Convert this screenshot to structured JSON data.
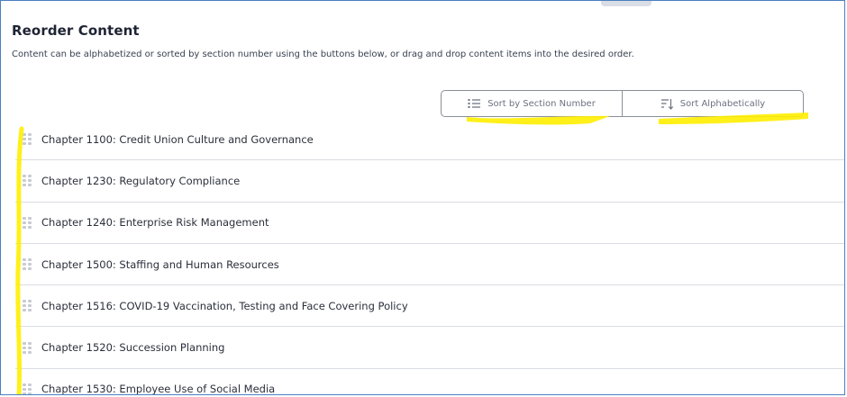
{
  "header": {
    "title": "Reorder Content",
    "description": "Content can be alphabetized or sorted by section number using the buttons below, or drag and drop content items into the desired order."
  },
  "sort_buttons": {
    "section": {
      "label": "Sort by Section Number",
      "icon": "list-ordered-icon"
    },
    "alpha": {
      "label": "Sort Alphabetically",
      "icon": "sort-descending-icon"
    }
  },
  "items": [
    {
      "label": "Chapter 1100: Credit Union Culture and Governance"
    },
    {
      "label": "Chapter 1230: Regulatory Compliance"
    },
    {
      "label": "Chapter 1240: Enterprise Risk Management"
    },
    {
      "label": "Chapter 1500: Staffing and Human Resources"
    },
    {
      "label": "Chapter 1516: COVID-19 Vaccination, Testing and Face Covering Policy"
    },
    {
      "label": "Chapter 1520: Succession Planning"
    },
    {
      "label": "Chapter 1530: Employee Use of Social Media"
    }
  ],
  "colors": {
    "highlighter": "#ffee00",
    "frame_border": "#4b7fc0",
    "row_divider": "#d9dce1"
  }
}
